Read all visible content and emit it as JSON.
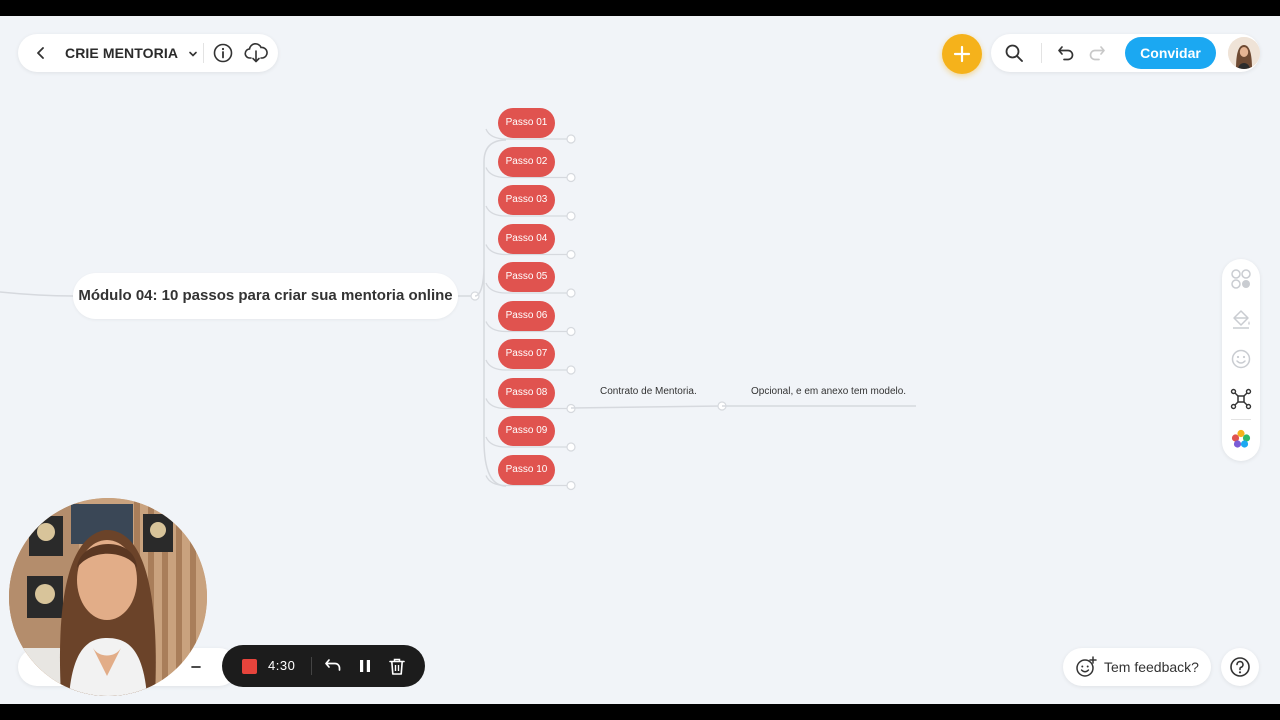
{
  "header": {
    "title": "CRIE MENTORIA",
    "invite_label": "Convidar",
    "accent": "#1ba8f2",
    "add_color": "#f5b21b"
  },
  "mindmap": {
    "central_topic": "Módulo 04: 10 passos para criar sua mentoria online",
    "steps": [
      "Passo 01",
      "Passo 02",
      "Passo 03",
      "Passo 04",
      "Passo 05",
      "Passo 06",
      "Passo 07",
      "Passo 08",
      "Passo 09",
      "Passo 10"
    ],
    "step_color": "#e0534f",
    "step08_subtopic": "Contrato de Mentoria.",
    "step08_note": "Opcional, e em anexo tem modelo."
  },
  "footer": {
    "feedback_label": "Tem feedback?",
    "recording_time": "4:30"
  },
  "icons": {
    "back": "chevron-left-icon",
    "title_dropdown": "chevron-down-icon",
    "info": "info-icon",
    "cloud": "cloud-download-icon",
    "search": "search-icon",
    "undo": "undo-icon",
    "redo": "redo-icon",
    "sidebar": [
      "layout-icon",
      "paint-icon",
      "emoji-icon",
      "structure-icon",
      "theme-icon"
    ],
    "help": "help-icon"
  }
}
